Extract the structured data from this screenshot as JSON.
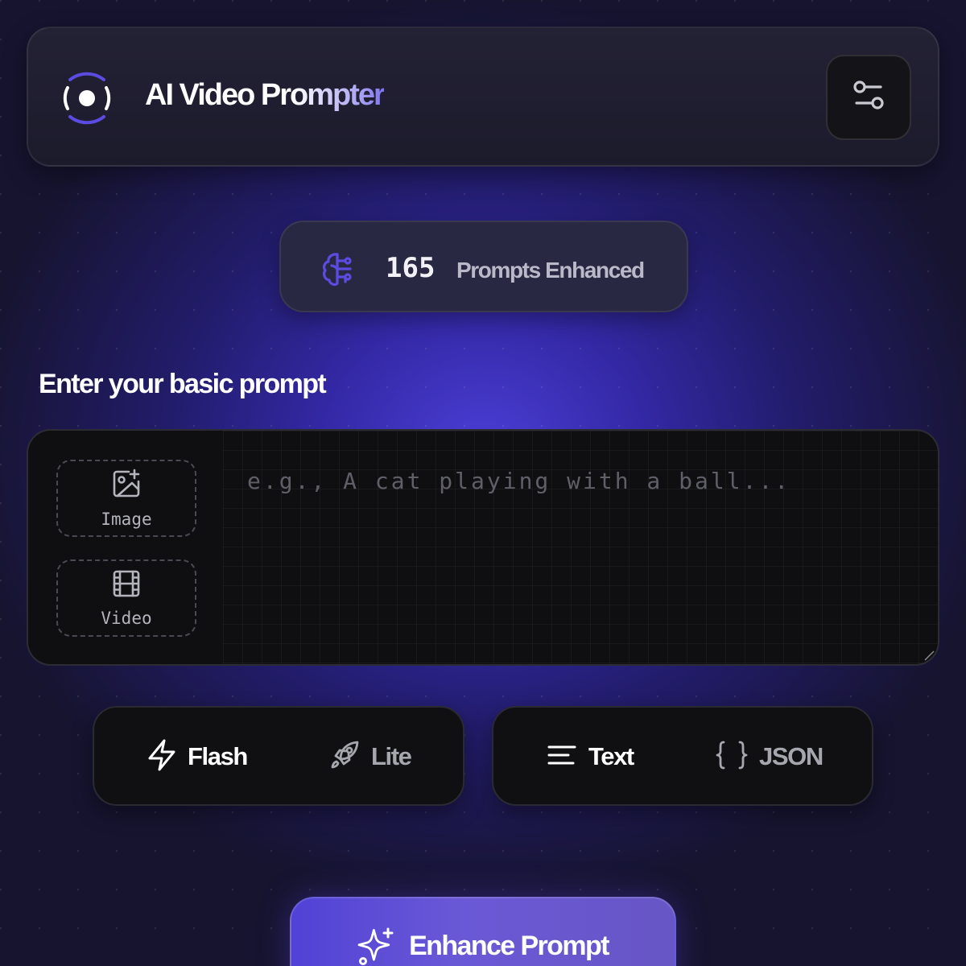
{
  "header": {
    "title": "AI Video Prompter",
    "logo_icon": "record-icon",
    "settings_icon": "sliders-icon"
  },
  "counter": {
    "icon": "brain-icon",
    "value": "165",
    "label": "Prompts Enhanced"
  },
  "prompt_section": {
    "title": "Enter your basic prompt",
    "placeholder": "e.g., A cat playing with a ball...",
    "value": "",
    "attachments": [
      {
        "label": "Image",
        "icon": "image-plus-icon"
      },
      {
        "label": "Video",
        "icon": "film-icon"
      }
    ]
  },
  "model_toggle": {
    "options": [
      {
        "label": "Flash",
        "icon": "zap-icon",
        "active": true
      },
      {
        "label": "Lite",
        "icon": "rocket-icon",
        "active": false
      }
    ]
  },
  "format_toggle": {
    "options": [
      {
        "label": "Text",
        "icon": "align-left-icon",
        "active": true
      },
      {
        "label": "JSON",
        "icon": "braces-icon",
        "active": false
      }
    ]
  },
  "enhance_button": {
    "label": "Enhance Prompt",
    "icon": "sparkles-icon"
  },
  "colors": {
    "accent": "#5b4be0",
    "background": "#16142f",
    "panel": "#0f0f12"
  }
}
